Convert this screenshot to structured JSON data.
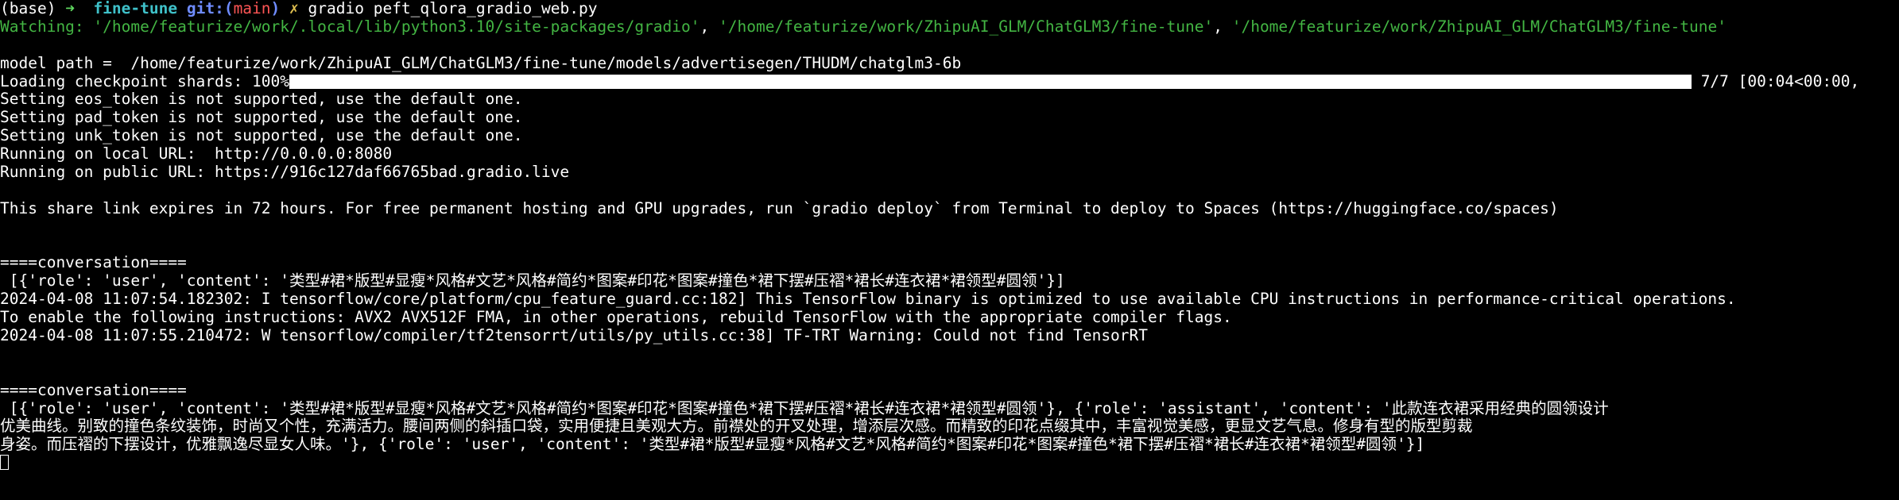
{
  "prompt": {
    "env": "(base)",
    "arrow": "➜",
    "dir": "fine-tune",
    "git_label": "git:(",
    "branch": "main",
    "git_close": ")",
    "dirty": "✗",
    "command": "gradio peft_qlora_gradio_web.py"
  },
  "watching": {
    "label": "Watching: ",
    "paths": [
      "'/home/featurize/work/.local/lib/python3.10/site-packages/gradio'",
      "'/home/featurize/work/ZhipuAI_GLM/ChatGLM3/fine-tune'",
      "'/home/featurize/work/ZhipuAI_GLM/ChatGLM3/fine-tune'"
    ],
    "sep": ", "
  },
  "model_path": "model path =  /home/featurize/work/ZhipuAI_GLM/ChatGLM3/fine-tune/models/advertisegen/THUDM/chatglm3-6b",
  "progress": {
    "label": "Loading checkpoint shards: 100%",
    "fraction": 1.0,
    "suffix": " 7/7 [00:04<00:00,"
  },
  "log_lines": [
    "Setting eos_token is not supported, use the default one.",
    "Setting pad_token is not supported, use the default one.",
    "Setting unk_token is not supported, use the default one.",
    "Running on local URL:  http://0.0.0.0:8080",
    "Running on public URL: https://916c127daf66765bad.gradio.live"
  ],
  "share_notice": "This share link expires in 72 hours. For free permanent hosting and GPU upgrades, run `gradio deploy` from Terminal to deploy to Spaces (https://huggingface.co/spaces)",
  "conversation1": {
    "header": "====conversation====",
    "body": " [{'role': 'user', 'content': '类型#裙*版型#显瘦*风格#文艺*风格#简约*图案#印花*图案#撞色*裙下摆#压褶*裙长#连衣裙*裙领型#圆领'}]"
  },
  "tf_lines": [
    "2024-04-08 11:07:54.182302: I tensorflow/core/platform/cpu_feature_guard.cc:182] This TensorFlow binary is optimized to use available CPU instructions in performance-critical operations.",
    "To enable the following instructions: AVX2 AVX512F FMA, in other operations, rebuild TensorFlow with the appropriate compiler flags.",
    "2024-04-08 11:07:55.210472: W tensorflow/compiler/tf2tensorrt/utils/py_utils.cc:38] TF-TRT Warning: Could not find TensorRT"
  ],
  "conversation2": {
    "header": "====conversation====",
    "lines": [
      " [{'role': 'user', 'content': '类型#裙*版型#显瘦*风格#文艺*风格#简约*图案#印花*图案#撞色*裙下摆#压褶*裙长#连衣裙*裙领型#圆领'}, {'role': 'assistant', 'content': '此款连衣裙采用经典的圆领设计",
      "优美曲线。别致的撞色条纹装饰，时尚又个性，充满活力。腰间两侧的斜插口袋，实用便捷且美观大方。前襟处的开叉处理，增添层次感。而精致的印花点缀其中，丰富视觉美感，更显文艺气息。修身有型的版型剪裁",
      "身姿。而压褶的下摆设计，优雅飘逸尽显女人味。'}, {'role': 'user', 'content': '类型#裙*版型#显瘦*风格#文艺*风格#简约*图案#印花*图案#撞色*裙下摆#压褶*裙长#连衣裙*裙领型#圆领'}]"
    ]
  },
  "colors": {
    "background": "#000000",
    "foreground": "#ffffff",
    "prompt_arrow": "#5fd75f",
    "dir": "#3fc1c9",
    "git": "#6f8cff",
    "branch": "#ff5555",
    "dirty": "#e0c050",
    "watch_paths": "#43b543"
  }
}
